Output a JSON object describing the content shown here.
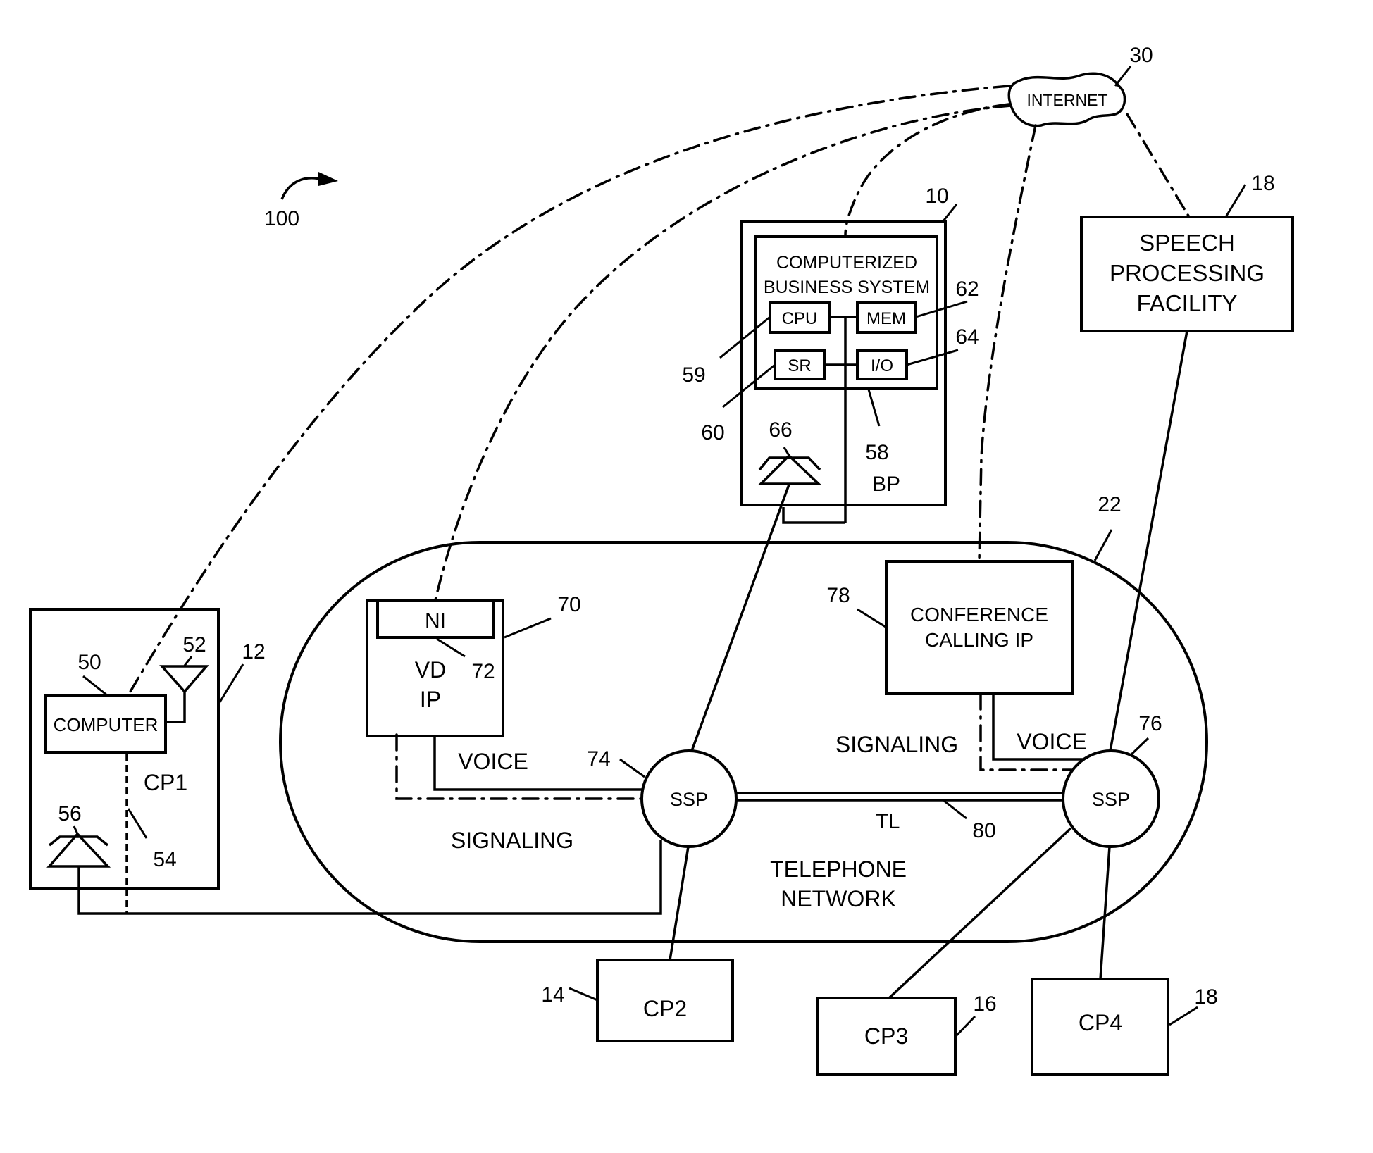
{
  "figure": {
    "system_ref": "100",
    "internet": {
      "label": "INTERNET",
      "ref": "30"
    },
    "business_premises": {
      "ref": "10",
      "label": "BP",
      "bus_ref": "58",
      "system_title_line1": "COMPUTERIZED",
      "system_title_line2": "BUSINESS SYSTEM",
      "cpu": {
        "label": "CPU",
        "ref": "59"
      },
      "mem": {
        "label": "MEM",
        "ref": "62"
      },
      "sr": {
        "label": "SR",
        "ref": "60"
      },
      "io": {
        "label": "I/O",
        "ref": "64"
      },
      "phone_ref": "66"
    },
    "speech_facility": {
      "ref": "18",
      "line1": "SPEECH",
      "line2": "PROCESSING",
      "line3": "FACILITY"
    },
    "cp1": {
      "label": "CP1",
      "ref": "12",
      "computer": {
        "label": "COMPUTER",
        "ref": "50"
      },
      "antenna_ref": "52",
      "line_ref": "54",
      "phone_ref": "56"
    },
    "telephone_network": {
      "ref": "22",
      "line1": "TELEPHONE",
      "line2": "NETWORK",
      "vd_ip": {
        "ni_label": "NI",
        "line1": "VD",
        "line2": "IP",
        "ref": "70",
        "ni_ref": "72"
      },
      "conference_ip": {
        "line1": "CONFERENCE",
        "line2": "CALLING IP",
        "ref": "78"
      },
      "ssp_left": {
        "label": "SSP",
        "ref": "74"
      },
      "ssp_right": {
        "label": "SSP",
        "ref": "76"
      },
      "trunk": {
        "label": "TL",
        "ref": "80"
      },
      "voice_left": "VOICE",
      "signaling_left": "SIGNALING",
      "voice_right": "VOICE",
      "signaling_right": "SIGNALING"
    },
    "cp2": {
      "label": "CP2",
      "ref": "14"
    },
    "cp3": {
      "label": "CP3",
      "ref": "16"
    },
    "cp4": {
      "label": "CP4",
      "ref": "18"
    }
  }
}
